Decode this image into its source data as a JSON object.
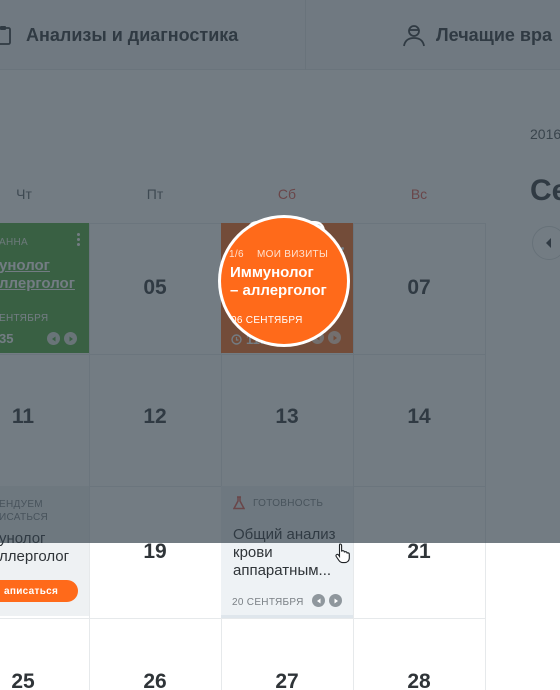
{
  "nav": {
    "diagnostics_label": "Анализы и диагностика",
    "doctors_label": "Лечащие вра"
  },
  "header": {
    "year": "2016",
    "month": "Се"
  },
  "weekdays": [
    "Чт",
    "Пт",
    "Сб",
    "Вс"
  ],
  "days": {
    "row1": [
      "05",
      "07"
    ],
    "row2": [
      "11",
      "12",
      "13",
      "14"
    ],
    "row3": [
      "19",
      "21"
    ],
    "row4": [
      "25",
      "26",
      "27",
      "28"
    ]
  },
  "card_green": {
    "label": "анна",
    "title": "унолог\nллерголог",
    "date": "ентября",
    "time": "35"
  },
  "card_visit": {
    "counter": "1/6",
    "category": "МОИ ВИЗИТЫ",
    "title": "Иммунолог\n– аллерголог",
    "date": "06 СЕНТЯБРЯ",
    "time": "11:30"
  },
  "card_recommend": {
    "label": "ендуем\nисаться",
    "title": "унолог\nллерголог",
    "button": "аписаться"
  },
  "card_analysis": {
    "status": "ГОТОВНОСТЬ",
    "title": "Общий анализ\nкрови\nаппаратным...",
    "date": "20 СЕНТЯБРЯ"
  },
  "colors": {
    "accent_orange": "#ff6a1a",
    "green": "#4ca83a",
    "weekend_red": "#e2574c",
    "tab_green": "#3bb34a",
    "tab_red": "#f0465a",
    "tab_gray": "#c9d3da"
  },
  "icons": {
    "diagnostics": "clipboard-icon",
    "doctors": "doctor-icon",
    "clock": "clock-icon",
    "flask": "flask-icon",
    "cursor": "hand-cursor-icon"
  }
}
